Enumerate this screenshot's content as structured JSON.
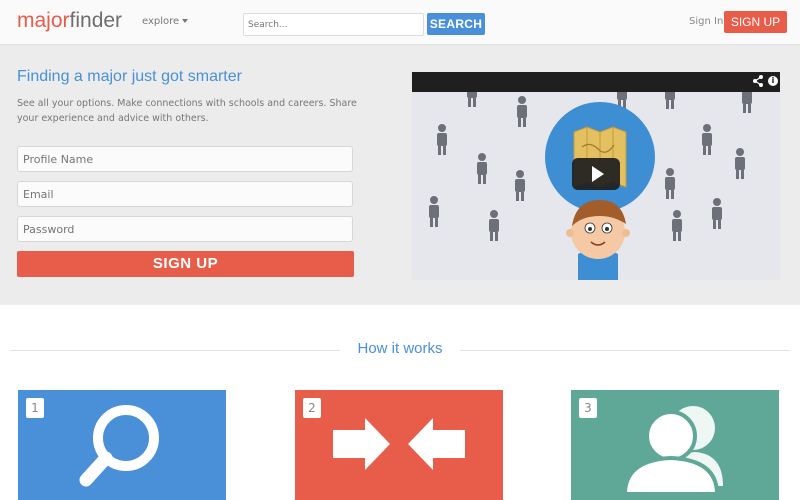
{
  "navbar": {
    "logo_part1": "major",
    "logo_part2": "finder",
    "explore_label": "explore",
    "search_placeholder": "Search...",
    "search_button": "SEARCH",
    "signin_label": "Sign In",
    "signup_label": "SIGN UP"
  },
  "hero": {
    "title": "Finding a major just got smarter",
    "description": "See all your options. Make connections with schools and careers. Share your experience and advice with others.",
    "fields": [
      {
        "placeholder": "Profile Name"
      },
      {
        "placeholder": "Email"
      },
      {
        "placeholder": "Password"
      }
    ],
    "signup_button": "SIGN UP"
  },
  "video": {
    "info_icon": "i",
    "play_icon": "play-icon"
  },
  "how": {
    "title": "How it works",
    "steps": [
      {
        "number": "1",
        "color": "#4a90d9",
        "icon": "search-icon"
      },
      {
        "number": "2",
        "color": "#e85c4a",
        "icon": "compare-arrows-icon"
      },
      {
        "number": "3",
        "color": "#5fa898",
        "icon": "people-icon"
      }
    ]
  },
  "colors": {
    "accent_blue": "#4a90d9",
    "accent_red": "#e85c4a",
    "accent_teal": "#5fa898"
  }
}
